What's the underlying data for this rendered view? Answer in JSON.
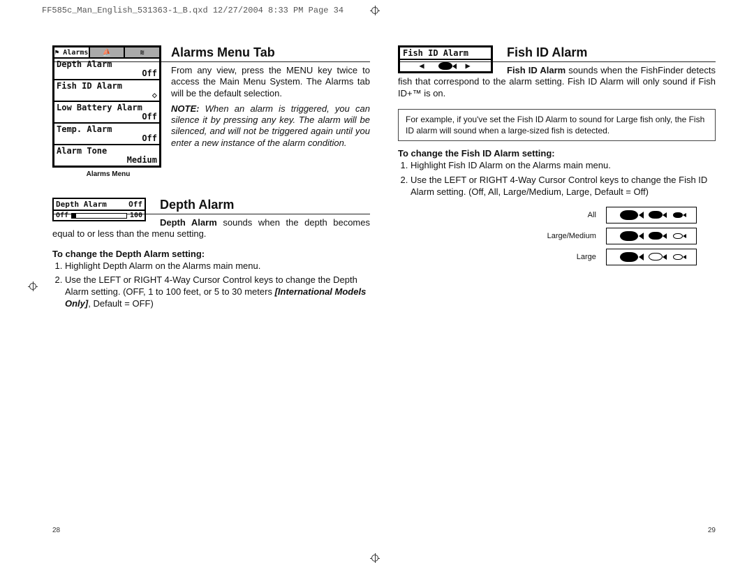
{
  "print_header": "FF585c_Man_English_531363-1_B.qxd  12/27/2004  8:33 PM  Page 34",
  "page_left_num": "28",
  "page_right_num": "29",
  "alarms_lcd": {
    "tab_active": "⚑ Alarms",
    "rows": [
      {
        "label": "Depth Alarm",
        "value": "Off"
      },
      {
        "label": "Fish ID Alarm",
        "value": "◇"
      },
      {
        "label": "Low Battery Alarm",
        "value": "Off"
      },
      {
        "label": "Temp. Alarm",
        "value": "Off"
      },
      {
        "label": "Alarm Tone",
        "value": "Medium"
      }
    ],
    "caption": "Alarms Menu"
  },
  "alarms_menu_tab": {
    "heading": "Alarms Menu Tab",
    "para": "From any view, press the MENU key twice to access the Main Menu System. The Alarms tab will be the default selection.",
    "note_lead": "NOTE:",
    "note": " When an alarm is triggered, you can silence it by pressing any key.  The alarm will be silenced, and will not be triggered again until you enter a new instance of the alarm condition."
  },
  "depth_mini": {
    "label": "Depth Alarm",
    "val": "Off",
    "min": "Off",
    "max": "100"
  },
  "depth_alarm": {
    "heading": "Depth Alarm",
    "lead": "Depth Alarm",
    "para": " sounds when the depth becomes equal to or less than the menu setting.",
    "change_h": "To change the Depth Alarm setting:",
    "steps": [
      "Highlight Depth Alarm on the Alarms main menu.",
      {
        "pre": "Use the LEFT or RIGHT 4-Way Cursor Control keys to change the Depth Alarm setting. (OFF, 1 to 100 feet, or 5 to 30 meters ",
        "intl": "[International Models Only]",
        "post": ", Default = OFF)"
      }
    ]
  },
  "fishid_lcd": {
    "label": "Fish ID Alarm"
  },
  "fish_id_alarm": {
    "heading": "Fish ID Alarm",
    "lead": "Fish ID Alarm",
    "para": " sounds when the FishFinder detects fish that correspond to the alarm setting. Fish ID Alarm will only sound if Fish ID+™ is on.",
    "example": "For example, if you've set the Fish ID Alarm to sound for Large fish only, the Fish ID alarm will sound when a large-sized fish is detected.",
    "change_h": "To change the Fish ID Alarm setting:",
    "steps": [
      "Highlight Fish ID Alarm on the Alarms main menu.",
      "Use the LEFT or RIGHT 4-Way Cursor Control keys to change the Fish ID Alarm setting. (Off, All, Large/Medium, Large, Default = Off)"
    ],
    "table_labels": {
      "all": "All",
      "lm": "Large/Medium",
      "lg": "Large"
    }
  }
}
